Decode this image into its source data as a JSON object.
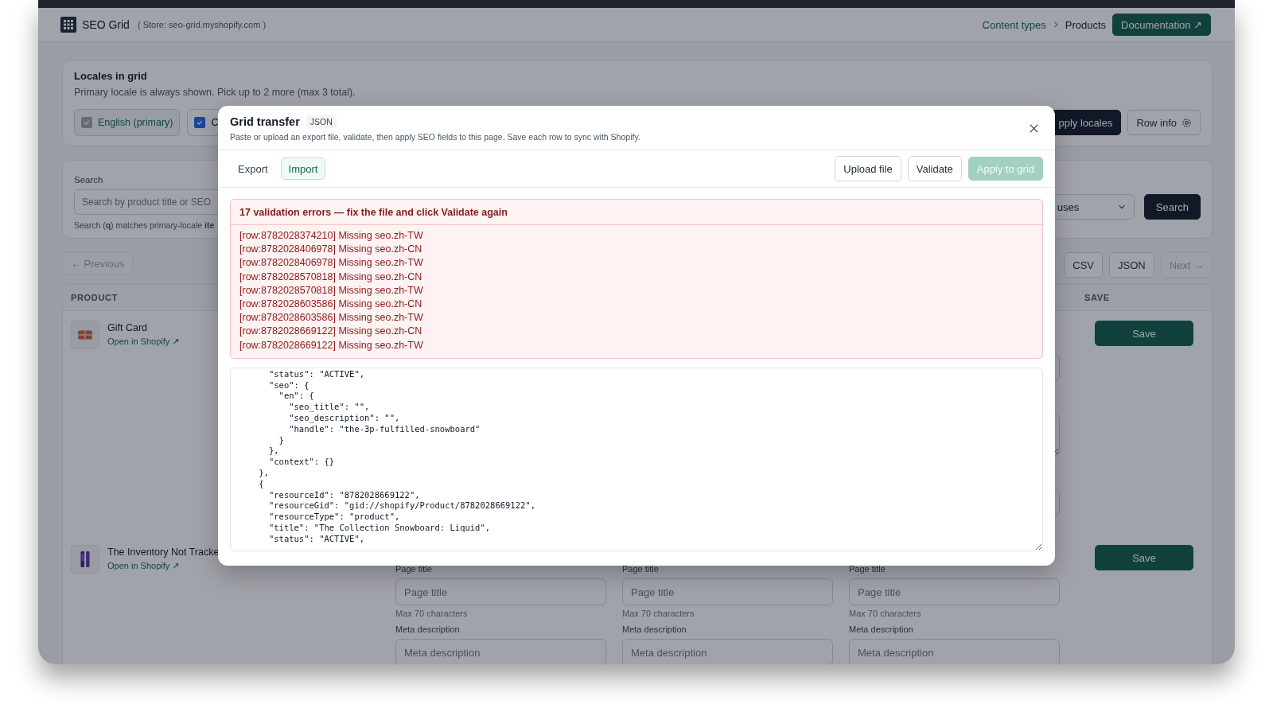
{
  "app": {
    "name": "SEO Grid",
    "store": "( Store: seo-grid.myshopify.com )"
  },
  "breadcrumbs": [
    {
      "label": "Content types",
      "current": false
    },
    {
      "label": "Products",
      "current": true
    }
  ],
  "documentation_button": "Documentation ↗",
  "locales": {
    "title": "Locales in grid",
    "hint": "Primary locale is always shown. Pick up to 2 more (max 3 total).",
    "chips": [
      {
        "label": "English (primary)",
        "checked": true,
        "disabled": true
      },
      {
        "label": "C",
        "checked": true,
        "disabled": false
      }
    ],
    "apply_button": "pply locales",
    "row_info_button": "Row info"
  },
  "search": {
    "label": "Search",
    "placeholder": "Search by product title or SEO",
    "hint": "Search (**q**) matches primary-locale **ite**",
    "status_select": "uses",
    "button": "Search"
  },
  "pagination": {
    "previous": {
      "label": "← Previous",
      "disabled": true
    },
    "exports": [
      "CSV",
      "JSON"
    ],
    "next": {
      "label": "Next →",
      "disabled": true
    }
  },
  "table": {
    "columns": [
      {
        "label": "PRODUCT",
        "kind": "product"
      },
      {
        "label": "SAVE",
        "kind": "save"
      }
    ],
    "rows": [
      {
        "title": "Gift Card",
        "link": "Open in Shopify ↗",
        "thumbnail": {
          "kind": "card"
        },
        "save": "Save",
        "locales": [
          {
            "fields": [
              {
                "kind": "input"
              },
              {
                "kind": "textarea"
              },
              {
                "kind": "input"
              }
            ]
          }
        ]
      },
      {
        "title": "The Inventory Not Tracke",
        "link": "Open in Shopify ↗",
        "thumbnail": {
          "kind": "boards"
        },
        "save": "Save",
        "locales": [
          {
            "fields": [
              {
                "kind": "input",
                "label": "Page title",
                "placeholder": "Page title",
                "hint": "Max 70 characters"
              },
              {
                "kind": "input",
                "label": "Meta description",
                "placeholder": "Meta description"
              }
            ]
          },
          {
            "fields": [
              {
                "kind": "input",
                "label": "Page title",
                "placeholder": "Page title",
                "hint": "Max 70 characters"
              },
              {
                "kind": "input",
                "label": "Meta description",
                "placeholder": "Meta description"
              }
            ]
          },
          {
            "fields": [
              {
                "kind": "input",
                "label": "Page title",
                "placeholder": "Page title",
                "hint": "Max 70 characters"
              },
              {
                "kind": "input",
                "label": "Meta description",
                "placeholder": "Meta description"
              }
            ]
          }
        ]
      }
    ]
  },
  "modal": {
    "title": "Grid transfer",
    "badge": "JSON",
    "subtitle": "Paste or upload an export file, validate, then apply SEO fields to this page. Save each row to sync with Shopify.",
    "tabs": [
      {
        "label": "Export",
        "selected": false
      },
      {
        "label": "Import",
        "selected": true
      }
    ],
    "actions": [
      {
        "label": "Upload file",
        "disabled": false,
        "kind": "secondary"
      },
      {
        "label": "Validate",
        "disabled": false,
        "kind": "secondary"
      },
      {
        "label": "Apply to grid",
        "disabled": true,
        "kind": "primary"
      }
    ],
    "errors": {
      "title": "17 validation errors — fix the file and click Validate again",
      "lines": [
        "[row:8782028374210] Missing seo.zh-TW",
        "[row:8782028406978] Missing seo.zh-CN",
        "[row:8782028406978] Missing seo.zh-TW",
        "[row:8782028570818] Missing seo.zh-CN",
        "[row:8782028570818] Missing seo.zh-TW",
        "[row:8782028603586] Missing seo.zh-CN",
        "[row:8782028603586] Missing seo.zh-TW",
        "[row:8782028669122] Missing seo.zh-CN",
        "[row:8782028669122] Missing seo.zh-TW"
      ]
    },
    "json_text": "      \"status\": \"ACTIVE\",\n      \"seo\": {\n        \"en\": {\n          \"seo_title\": \"\",\n          \"seo_description\": \"\",\n          \"handle\": \"the-3p-fulfilled-snowboard\"\n        }\n      },\n      \"context\": {}\n    },\n    {\n      \"resourceId\": \"8782028669122\",\n      \"resourceGid\": \"gid://shopify/Product/8782028669122\",\n      \"resourceType\": \"product\",\n      \"title\": \"The Collection Snowboard: Liquid\",\n      \"status\": \"ACTIVE\","
  }
}
